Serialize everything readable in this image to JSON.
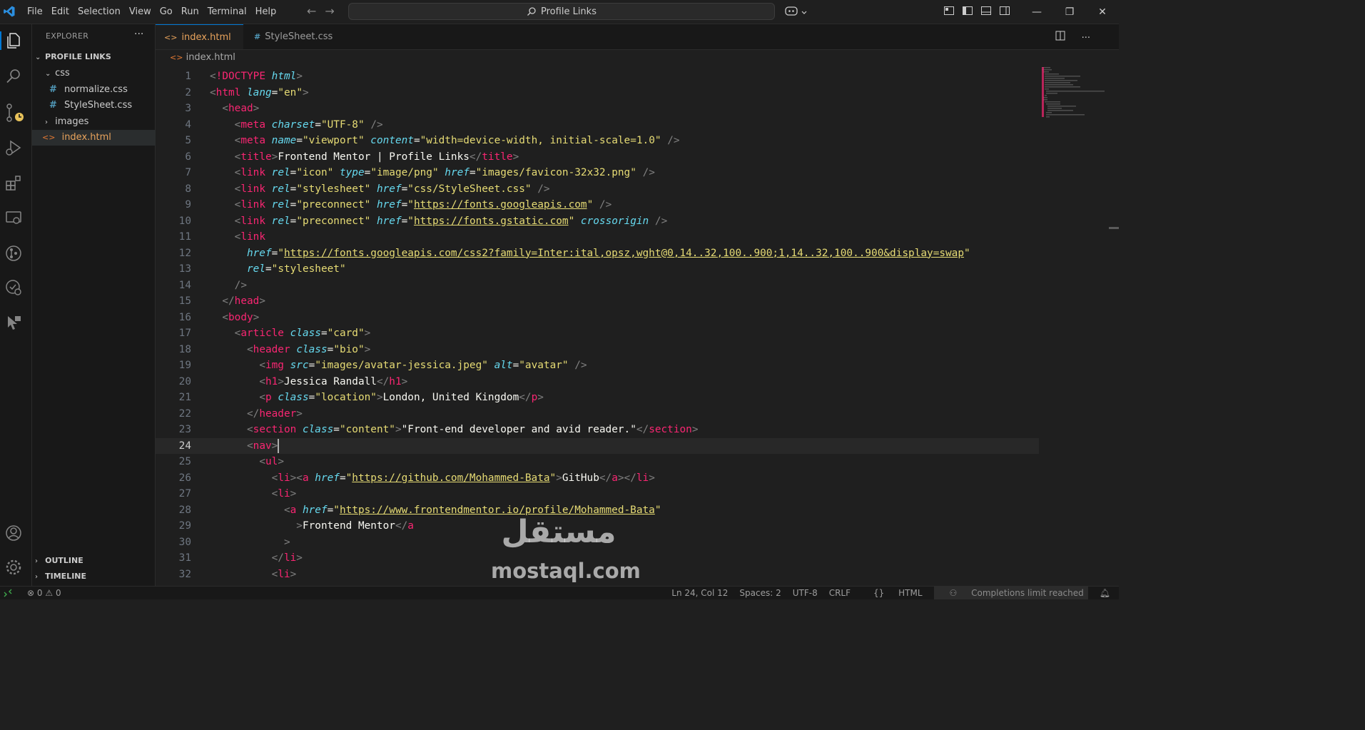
{
  "titlebar": {
    "menu": [
      "File",
      "Edit",
      "Selection",
      "View",
      "Go",
      "Run",
      "Terminal",
      "Help"
    ],
    "search": "Profile Links"
  },
  "sidebar": {
    "title": "EXPLORER",
    "project": "PROFILE LINKS",
    "items": [
      {
        "label": "css",
        "type": "folder"
      },
      {
        "label": "normalize.css",
        "type": "css"
      },
      {
        "label": "StyleSheet.css",
        "type": "css"
      },
      {
        "label": "images",
        "type": "folder"
      },
      {
        "label": "index.html",
        "type": "html"
      }
    ],
    "outline": "OUTLINE",
    "timeline": "TIMELINE"
  },
  "tabs": [
    {
      "label": "index.html",
      "active": true
    },
    {
      "label": "StyleSheet.css",
      "active": false
    }
  ],
  "breadcrumb": "index.html",
  "editor": {
    "current_line": 24,
    "lines": [
      [
        [
          "t-b",
          "<"
        ],
        [
          "t-doct",
          "!DOCTYPE "
        ],
        [
          "t-kw",
          "html"
        ],
        [
          "t-b",
          ">"
        ]
      ],
      [
        [
          "t-b",
          "<"
        ],
        [
          "t-tag",
          "html "
        ],
        [
          "t-attr",
          "lang"
        ],
        [
          "t-text",
          "="
        ],
        [
          "t-str",
          "\"en\""
        ],
        [
          "t-b",
          ">"
        ]
      ],
      [
        [
          "t-text",
          "  "
        ],
        [
          "t-b",
          "<"
        ],
        [
          "t-tag",
          "head"
        ],
        [
          "t-b",
          ">"
        ]
      ],
      [
        [
          "t-text",
          "    "
        ],
        [
          "t-b",
          "<"
        ],
        [
          "t-tag",
          "meta "
        ],
        [
          "t-attr",
          "charset"
        ],
        [
          "t-text",
          "="
        ],
        [
          "t-str",
          "\"UTF-8\""
        ],
        [
          "t-text",
          " "
        ],
        [
          "t-b",
          "/>"
        ]
      ],
      [
        [
          "t-text",
          "    "
        ],
        [
          "t-b",
          "<"
        ],
        [
          "t-tag",
          "meta "
        ],
        [
          "t-attr",
          "name"
        ],
        [
          "t-text",
          "="
        ],
        [
          "t-str",
          "\"viewport\""
        ],
        [
          "t-text",
          " "
        ],
        [
          "t-attr",
          "content"
        ],
        [
          "t-text",
          "="
        ],
        [
          "t-str",
          "\"width=device-width, initial-scale=1.0\""
        ],
        [
          "t-text",
          " "
        ],
        [
          "t-b",
          "/>"
        ]
      ],
      [
        [
          "t-text",
          "    "
        ],
        [
          "t-b",
          "<"
        ],
        [
          "t-tag",
          "title"
        ],
        [
          "t-b",
          ">"
        ],
        [
          "t-text",
          "Frontend Mentor | Profile Links"
        ],
        [
          "t-b",
          "</"
        ],
        [
          "t-tag",
          "title"
        ],
        [
          "t-b",
          ">"
        ]
      ],
      [
        [
          "t-text",
          "    "
        ],
        [
          "t-b",
          "<"
        ],
        [
          "t-tag",
          "link "
        ],
        [
          "t-attr",
          "rel"
        ],
        [
          "t-text",
          "="
        ],
        [
          "t-str",
          "\"icon\""
        ],
        [
          "t-text",
          " "
        ],
        [
          "t-attr",
          "type"
        ],
        [
          "t-text",
          "="
        ],
        [
          "t-str",
          "\"image/png\""
        ],
        [
          "t-text",
          " "
        ],
        [
          "t-attr",
          "href"
        ],
        [
          "t-text",
          "="
        ],
        [
          "t-str",
          "\"images/favicon-32x32.png\""
        ],
        [
          "t-text",
          " "
        ],
        [
          "t-b",
          "/>"
        ]
      ],
      [
        [
          "t-text",
          "    "
        ],
        [
          "t-b",
          "<"
        ],
        [
          "t-tag",
          "link "
        ],
        [
          "t-attr",
          "rel"
        ],
        [
          "t-text",
          "="
        ],
        [
          "t-str",
          "\"stylesheet\""
        ],
        [
          "t-text",
          " "
        ],
        [
          "t-attr",
          "href"
        ],
        [
          "t-text",
          "="
        ],
        [
          "t-str",
          "\"css/StyleSheet.css\""
        ],
        [
          "t-text",
          " "
        ],
        [
          "t-b",
          "/>"
        ]
      ],
      [
        [
          "t-text",
          "    "
        ],
        [
          "t-b",
          "<"
        ],
        [
          "t-tag",
          "link "
        ],
        [
          "t-attr",
          "rel"
        ],
        [
          "t-text",
          "="
        ],
        [
          "t-str",
          "\"preconnect\""
        ],
        [
          "t-text",
          " "
        ],
        [
          "t-attr",
          "href"
        ],
        [
          "t-text",
          "="
        ],
        [
          "t-str",
          "\""
        ],
        [
          "t-url",
          "https://fonts.googleapis.com"
        ],
        [
          "t-str",
          "\""
        ],
        [
          "t-text",
          " "
        ],
        [
          "t-b",
          "/>"
        ]
      ],
      [
        [
          "t-text",
          "    "
        ],
        [
          "t-b",
          "<"
        ],
        [
          "t-tag",
          "link "
        ],
        [
          "t-attr",
          "rel"
        ],
        [
          "t-text",
          "="
        ],
        [
          "t-str",
          "\"preconnect\""
        ],
        [
          "t-text",
          " "
        ],
        [
          "t-attr",
          "href"
        ],
        [
          "t-text",
          "="
        ],
        [
          "t-str",
          "\""
        ],
        [
          "t-url",
          "https://fonts.gstatic.com"
        ],
        [
          "t-str",
          "\""
        ],
        [
          "t-text",
          " "
        ],
        [
          "t-attr",
          "crossorigin"
        ],
        [
          "t-text",
          " "
        ],
        [
          "t-b",
          "/>"
        ]
      ],
      [
        [
          "t-text",
          "    "
        ],
        [
          "t-b",
          "<"
        ],
        [
          "t-tag",
          "link"
        ]
      ],
      [
        [
          "t-text",
          "      "
        ],
        [
          "t-attr",
          "href"
        ],
        [
          "t-text",
          "="
        ],
        [
          "t-str",
          "\""
        ],
        [
          "t-url",
          "https://fonts.googleapis.com/css2?family=Inter:ital,opsz,wght@0,14..32,100..900;1,14..32,100..900&display=swap"
        ],
        [
          "t-str",
          "\""
        ]
      ],
      [
        [
          "t-text",
          "      "
        ],
        [
          "t-attr",
          "rel"
        ],
        [
          "t-text",
          "="
        ],
        [
          "t-str",
          "\"stylesheet\""
        ]
      ],
      [
        [
          "t-text",
          "    "
        ],
        [
          "t-b",
          "/>"
        ]
      ],
      [
        [
          "t-text",
          "  "
        ],
        [
          "t-b",
          "</"
        ],
        [
          "t-tag",
          "head"
        ],
        [
          "t-b",
          ">"
        ]
      ],
      [
        [
          "t-text",
          "  "
        ],
        [
          "t-b",
          "<"
        ],
        [
          "t-tag",
          "body"
        ],
        [
          "t-b",
          ">"
        ]
      ],
      [
        [
          "t-text",
          "    "
        ],
        [
          "t-b",
          "<"
        ],
        [
          "t-tag",
          "article "
        ],
        [
          "t-attr",
          "class"
        ],
        [
          "t-text",
          "="
        ],
        [
          "t-str",
          "\"card\""
        ],
        [
          "t-b",
          ">"
        ]
      ],
      [
        [
          "t-text",
          "      "
        ],
        [
          "t-b",
          "<"
        ],
        [
          "t-tag",
          "header "
        ],
        [
          "t-attr",
          "class"
        ],
        [
          "t-text",
          "="
        ],
        [
          "t-str",
          "\"bio\""
        ],
        [
          "t-b",
          ">"
        ]
      ],
      [
        [
          "t-text",
          "        "
        ],
        [
          "t-b",
          "<"
        ],
        [
          "t-tag",
          "img "
        ],
        [
          "t-attr",
          "src"
        ],
        [
          "t-text",
          "="
        ],
        [
          "t-str",
          "\"images/avatar-jessica.jpeg\""
        ],
        [
          "t-text",
          " "
        ],
        [
          "t-attr",
          "alt"
        ],
        [
          "t-text",
          "="
        ],
        [
          "t-str",
          "\"avatar\""
        ],
        [
          "t-text",
          " "
        ],
        [
          "t-b",
          "/>"
        ]
      ],
      [
        [
          "t-text",
          "        "
        ],
        [
          "t-b",
          "<"
        ],
        [
          "t-tag",
          "h1"
        ],
        [
          "t-b",
          ">"
        ],
        [
          "t-text",
          "Jessica Randall"
        ],
        [
          "t-b",
          "</"
        ],
        [
          "t-tag",
          "h1"
        ],
        [
          "t-b",
          ">"
        ]
      ],
      [
        [
          "t-text",
          "        "
        ],
        [
          "t-b",
          "<"
        ],
        [
          "t-tag",
          "p "
        ],
        [
          "t-attr",
          "class"
        ],
        [
          "t-text",
          "="
        ],
        [
          "t-str",
          "\"location\""
        ],
        [
          "t-b",
          ">"
        ],
        [
          "t-text",
          "London, United Kingdom"
        ],
        [
          "t-b",
          "</"
        ],
        [
          "t-tag",
          "p"
        ],
        [
          "t-b",
          ">"
        ]
      ],
      [
        [
          "t-text",
          "      "
        ],
        [
          "t-b",
          "</"
        ],
        [
          "t-tag",
          "header"
        ],
        [
          "t-b",
          ">"
        ]
      ],
      [
        [
          "t-text",
          "      "
        ],
        [
          "t-b",
          "<"
        ],
        [
          "t-tag",
          "section "
        ],
        [
          "t-attr",
          "class"
        ],
        [
          "t-text",
          "="
        ],
        [
          "t-str",
          "\"content\""
        ],
        [
          "t-b",
          ">"
        ],
        [
          "t-text",
          "\"Front-end developer and avid reader.\""
        ],
        [
          "t-b",
          "</"
        ],
        [
          "t-tag",
          "section"
        ],
        [
          "t-b",
          ">"
        ]
      ],
      [
        [
          "t-text",
          "      "
        ],
        [
          "t-b",
          "<"
        ],
        [
          "t-tag",
          "nav"
        ],
        [
          "t-b",
          ">"
        ]
      ],
      [
        [
          "t-text",
          "        "
        ],
        [
          "t-b",
          "<"
        ],
        [
          "t-tag",
          "ul"
        ],
        [
          "t-b",
          ">"
        ]
      ],
      [
        [
          "t-text",
          "          "
        ],
        [
          "t-b",
          "<"
        ],
        [
          "t-tag",
          "li"
        ],
        [
          "t-b",
          "><"
        ],
        [
          "t-tag",
          "a "
        ],
        [
          "t-attr",
          "href"
        ],
        [
          "t-text",
          "="
        ],
        [
          "t-str",
          "\""
        ],
        [
          "t-url",
          "https://github.com/Mohammed-Bata"
        ],
        [
          "t-str",
          "\""
        ],
        [
          "t-b",
          ">"
        ],
        [
          "t-text",
          "GitHub"
        ],
        [
          "t-b",
          "</"
        ],
        [
          "t-tag",
          "a"
        ],
        [
          "t-b",
          "></"
        ],
        [
          "t-tag",
          "li"
        ],
        [
          "t-b",
          ">"
        ]
      ],
      [
        [
          "t-text",
          "          "
        ],
        [
          "t-b",
          "<"
        ],
        [
          "t-tag",
          "li"
        ],
        [
          "t-b",
          ">"
        ]
      ],
      [
        [
          "t-text",
          "            "
        ],
        [
          "t-b",
          "<"
        ],
        [
          "t-tag",
          "a "
        ],
        [
          "t-attr",
          "href"
        ],
        [
          "t-text",
          "="
        ],
        [
          "t-str",
          "\""
        ],
        [
          "t-url",
          "https://www.frontendmentor.io/profile/Mohammed-Bata"
        ],
        [
          "t-str",
          "\""
        ]
      ],
      [
        [
          "t-text",
          "              "
        ],
        [
          "t-b",
          ">"
        ],
        [
          "t-text",
          "Frontend Mentor"
        ],
        [
          "t-b",
          "</"
        ],
        [
          "t-tag",
          "a"
        ]
      ],
      [
        [
          "t-text",
          "            "
        ],
        [
          "t-b",
          ">"
        ]
      ],
      [
        [
          "t-text",
          "          "
        ],
        [
          "t-b",
          "</"
        ],
        [
          "t-tag",
          "li"
        ],
        [
          "t-b",
          ">"
        ]
      ],
      [
        [
          "t-text",
          "          "
        ],
        [
          "t-b",
          "<"
        ],
        [
          "t-tag",
          "li"
        ],
        [
          "t-b",
          ">"
        ]
      ]
    ]
  },
  "watermark": {
    "arabic": "مستقل",
    "latin": "mostaql.com"
  },
  "statusbar": {
    "errors": "0",
    "warnings": "0",
    "position": "Ln 24, Col 12",
    "spaces": "Spaces: 2",
    "encoding": "UTF-8",
    "eol": "CRLF",
    "language": "HTML",
    "completions": "Completions limit reached"
  }
}
